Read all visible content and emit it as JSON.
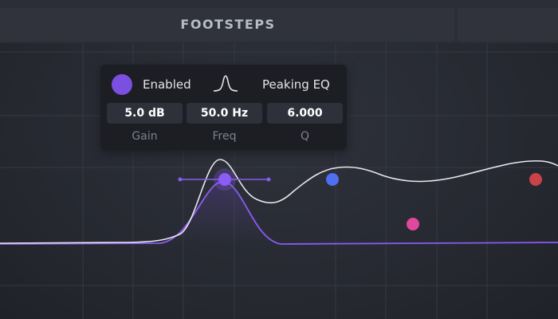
{
  "header": {
    "title": "FOOTSTEPS"
  },
  "popup": {
    "enabled_label": "Enabled",
    "filter_icon": "peaking-curve-icon",
    "filter_type": "Peaking EQ",
    "params": [
      {
        "value": "5.0 dB",
        "label": "Gain"
      },
      {
        "value": "50.0 Hz",
        "label": "Freq"
      },
      {
        "value": "6.000",
        "label": "Q"
      }
    ]
  },
  "bands": [
    {
      "name": "band-1",
      "color": "#8b5cf6",
      "selected": true
    },
    {
      "name": "band-2",
      "color": "#4f6ef0"
    },
    {
      "name": "band-3",
      "color": "#e0489b"
    },
    {
      "name": "band-4",
      "color": "#c94348"
    }
  ],
  "colors": {
    "accent": "#7b4fe0",
    "response_curve": "#e8e8ee",
    "band_curve": "#8a5cf0",
    "grid": "#363944"
  }
}
